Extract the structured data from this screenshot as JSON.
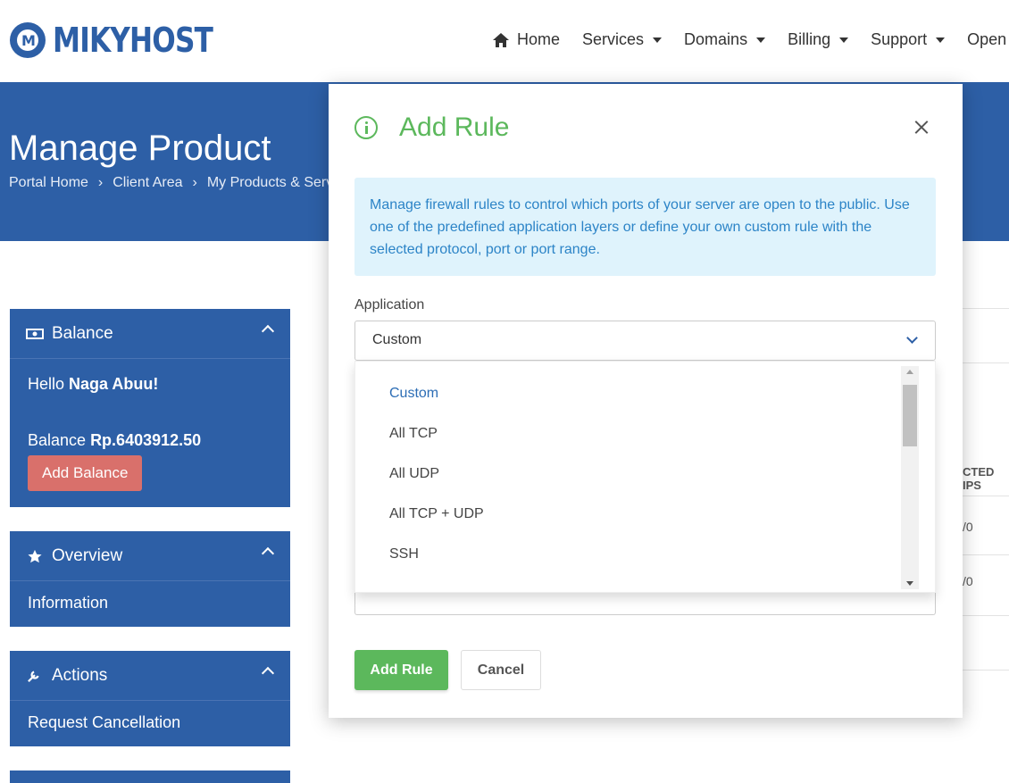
{
  "brand": {
    "name": "MIKYHOST",
    "logo_letter": "M"
  },
  "nav": [
    {
      "label": "Home",
      "icon": "home-icon",
      "dropdown": false
    },
    {
      "label": "Services",
      "dropdown": true
    },
    {
      "label": "Domains",
      "dropdown": true
    },
    {
      "label": "Billing",
      "dropdown": true
    },
    {
      "label": "Support",
      "dropdown": true
    },
    {
      "label": "Open T",
      "dropdown": false
    }
  ],
  "hero": {
    "title": "Manage Product",
    "breadcrumb": [
      "Portal Home",
      "Client Area",
      "My Products & Serv"
    ]
  },
  "sidebar": {
    "balance": {
      "title": "Balance",
      "hello_prefix": "Hello ",
      "user": "Naga Abuu!",
      "balance_prefix": "Balance ",
      "amount": "Rp.6403912.50",
      "button": "Add Balance"
    },
    "overview": {
      "title": "Overview",
      "item": "Information"
    },
    "actions": {
      "title": "Actions",
      "item": "Request Cancellation"
    }
  },
  "background_table": {
    "header_fragment": "CTED IPS",
    "cell1": "/0",
    "cell2": "/0"
  },
  "modal": {
    "title": "Add Rule",
    "info": "Manage firewall rules to control which ports of your server are open to the public. Use one of the predefined application layers or define your own custom rule with the selected protocol, port or port range.",
    "application_label": "Application",
    "selected": "Custom",
    "options": [
      "Custom",
      "All TCP",
      "All UDP",
      "All TCP + UDP",
      "SSH"
    ],
    "add_button": "Add Rule",
    "cancel_button": "Cancel"
  },
  "colors": {
    "brand_blue": "#2d5fa6",
    "success_green": "#5cb85c",
    "info_bg": "#dff3fc",
    "info_text": "#2c84c7",
    "danger_soft": "#d9706b"
  }
}
